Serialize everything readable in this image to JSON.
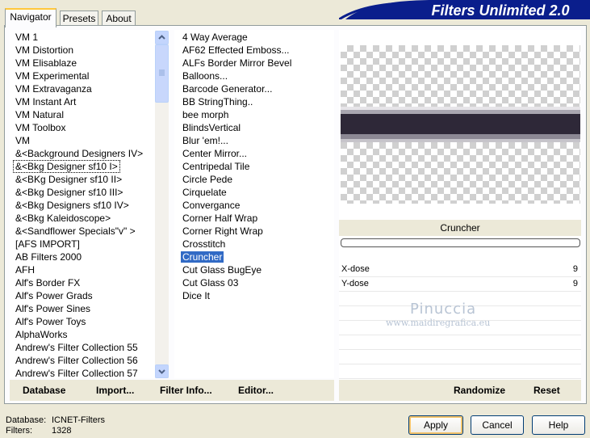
{
  "tabs": [
    {
      "label": "Navigator",
      "active": true
    },
    {
      "label": "Presets",
      "active": false
    },
    {
      "label": "About",
      "active": false
    }
  ],
  "app_title": "Filters Unlimited 2.0",
  "categories": [
    "VM 1",
    "VM Distortion",
    "VM Elisablaze",
    "VM Experimental",
    "VM Extravaganza",
    "VM Instant Art",
    "VM Natural",
    "VM Toolbox",
    "VM",
    "&<Background Designers IV>",
    "&<Bkg Designer sf10 I>",
    "&<BKg Designer sf10 II>",
    "&<Bkg Designer sf10 III>",
    "&<Bkg Designers sf10 IV>",
    "&<Bkg Kaleidoscope>",
    "&<Sandflower Specials\"v\" >",
    "[AFS IMPORT]",
    "AB Filters 2000",
    "AFH",
    "Alf's Border FX",
    "Alf's Power Grads",
    "Alf's Power Sines",
    "Alf's Power Toys",
    "AlphaWorks",
    "Andrew's Filter Collection 55",
    "Andrew's Filter Collection 56",
    "Andrew's Filter Collection 57"
  ],
  "selected_category": "&<Bkg Designer sf10 I>",
  "filters": [
    "4 Way Average",
    "AF62 Effected Emboss...",
    "ALFs Border Mirror Bevel",
    "Balloons...",
    "Barcode Generator...",
    "BB StringThing..",
    "bee morph",
    "BlindsVertical",
    "Blur 'em!...",
    "Center Mirror...",
    "Centripedal Tile",
    "Circle Pede",
    "Cirquelate",
    "Convergance",
    "Corner Half Wrap",
    "Corner Right Wrap",
    "Crosstitch",
    "Cruncher",
    "Cut Glass  BugEye",
    "Cut Glass 03",
    "Dice It"
  ],
  "selected_filter": "Cruncher",
  "preview_filter_name": "Cruncher",
  "params": [
    {
      "label": "X-dose",
      "value": "9"
    },
    {
      "label": "Y-dose",
      "value": "9"
    }
  ],
  "watermark": {
    "line1": "Pinuccia",
    "line2": "www.maidiregrafica.eu"
  },
  "bottom_buttons": {
    "database": "Database",
    "import": "Import...",
    "filter_info": "Filter Info...",
    "editor": "Editor...",
    "randomize": "Randomize",
    "reset": "Reset"
  },
  "status": {
    "database_label": "Database:",
    "database_value": "ICNET-Filters",
    "filters_label": "Filters:",
    "filters_value": "1328"
  },
  "dialog_buttons": {
    "apply": "Apply",
    "cancel": "Cancel",
    "help": "Help"
  },
  "colors": {
    "selection": "#316AC5",
    "banner": "#0A1E8C",
    "face": "#ECE9D8"
  }
}
